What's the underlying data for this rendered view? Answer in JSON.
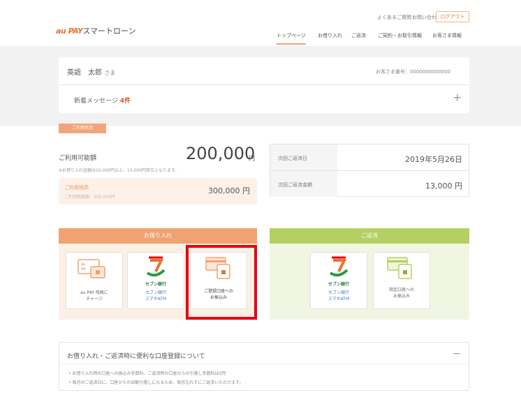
{
  "header": {
    "logo_brand": "au PAY",
    "logo_text": "スマートローン",
    "util_faq": "よくあるご質問",
    "util_contact": "お問い合わせ",
    "logout": "ログアウト",
    "nav": [
      "トップページ",
      "お借り入れ",
      "ご返済",
      "ご契約・お取引情報",
      "お客さま情報"
    ]
  },
  "user": {
    "name": "英語　太郎",
    "honorific": "さま",
    "member_no": "お客さま番号：0000000000000",
    "message_label": "新着メッセージ",
    "message_count": "4件"
  },
  "usage": {
    "tag": "ご利用状況",
    "limit_label": "ご利用可能額",
    "limit_amount": "200,000",
    "limit_unit": "円",
    "limit_note": "※お借り入れ金額は10,000円以上、10,000円単位となります。",
    "balance_label": "ご利用残高",
    "balance_sub": "ご利用限度額：500,000円",
    "balance_amount": "300,000 円"
  },
  "repayment": {
    "date_label": "次回ご返済日",
    "date_value": "2019年5月26日",
    "amount_label": "次回ご返済金額",
    "amount_value": "13,000 円"
  },
  "borrow": {
    "heading": "お借り入れ",
    "tiles": [
      {
        "line1": "au PAY 残高に",
        "line2": "チャージ",
        "line3": ""
      },
      {
        "line1": "セブン銀行",
        "line2": "スマホATM",
        "line3": ""
      },
      {
        "line1": "ご登録口座への",
        "line2": "お振込み",
        "line3": ""
      }
    ],
    "seven_bank": "セブン銀行"
  },
  "repay": {
    "heading": "ご返済",
    "tiles": [
      {
        "line1": "セブン銀行",
        "line2": "スマホATM"
      },
      {
        "line1": "指定口座への",
        "line2": "お振込み"
      }
    ],
    "seven_bank": "セブン銀行"
  },
  "info": {
    "title": "お借り入れ・ご返済時に便利な口座登録について",
    "bullets": [
      "お借り入れ時の口座への振込み手数料、ご返済時の口座からの引落し手数料は0円",
      "毎月のご返済日に、口座からの自動引落しになるため、毎月忘れずにご返済いただけます。"
    ]
  },
  "colors": {
    "accent_orange": "#f1a271",
    "accent_green": "#b4d063",
    "highlight_red": "#e60012"
  }
}
